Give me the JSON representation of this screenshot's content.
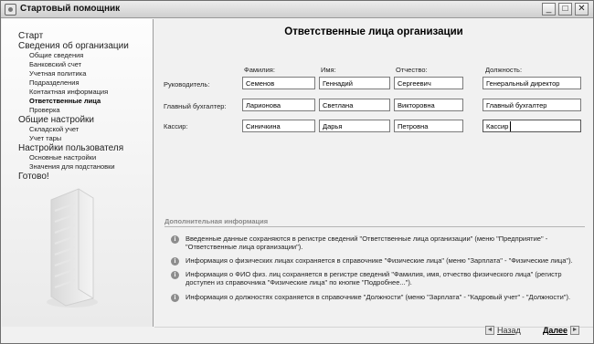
{
  "window": {
    "title": "Стартовый помощник",
    "minimize": "_",
    "maximize": "□",
    "close": "✕"
  },
  "sidebar": {
    "items": [
      {
        "label": "Старт",
        "level": 1
      },
      {
        "label": "Сведения об организации",
        "level": 1
      },
      {
        "label": "Общие сведения",
        "level": 2
      },
      {
        "label": "Банковский счет",
        "level": 2
      },
      {
        "label": "Учетная политика",
        "level": 2
      },
      {
        "label": "Подразделения",
        "level": 2
      },
      {
        "label": "Контактная информация",
        "level": 2
      },
      {
        "label": "Ответственные лица",
        "level": 2,
        "active": true
      },
      {
        "label": "Проверка",
        "level": 2
      },
      {
        "label": "Общие настройки",
        "level": 1
      },
      {
        "label": "Складской учет",
        "level": 2
      },
      {
        "label": "Учет тары",
        "level": 2
      },
      {
        "label": "Настройки пользователя",
        "level": 1
      },
      {
        "label": "Основные настройки",
        "level": 2
      },
      {
        "label": "Значения для подстановки",
        "level": 2
      },
      {
        "label": "Готово!",
        "level": 1
      }
    ]
  },
  "main": {
    "title": "Ответственные лица организации",
    "columns": {
      "lastname": "Фамилия:",
      "firstname": "Имя:",
      "middlename": "Отчество:",
      "position": "Должность:"
    },
    "rows": [
      {
        "label": "Руководитель:",
        "lastname": "Семенов",
        "firstname": "Геннадий",
        "middlename": "Сергеевич",
        "position": "Генеральный директор"
      },
      {
        "label": "Главный бухгалтер:",
        "lastname": "Ларионова",
        "firstname": "Светлана",
        "middlename": "Викторовна",
        "position": "Главный бухгалтер"
      },
      {
        "label": "Кассир:",
        "lastname": "Синичкина",
        "firstname": "Дарья",
        "middlename": "Петровна",
        "position": "Кассир"
      }
    ],
    "info": {
      "header": "Дополнительная информация",
      "items": [
        "Введенные данные сохраняются в регистре сведений \"Ответственные лица организации\" (меню \"Предприятие\" - \"Ответственные лица организации\").",
        "Информация о физических лицах сохраняется в справочнике \"Физические лица\" (меню \"Зарплата\" - \"Физические лица\").",
        "Информация о ФИО физ. лиц сохраняется в регистре сведений \"Фамилия, имя, отчество физического лица\" (регистр доступен из справочника \"Физические лица\" по кнопке \"Подробнее...\").",
        "Информация о должностях сохраняется в справочнике \"Должности\" (меню \"Зарплата\" - \"Кадровый учет\" - \"Должности\")."
      ]
    }
  },
  "footer": {
    "back_label": "Назад",
    "next_label": "Далее",
    "back_arrow": "◄",
    "next_arrow": "►"
  }
}
